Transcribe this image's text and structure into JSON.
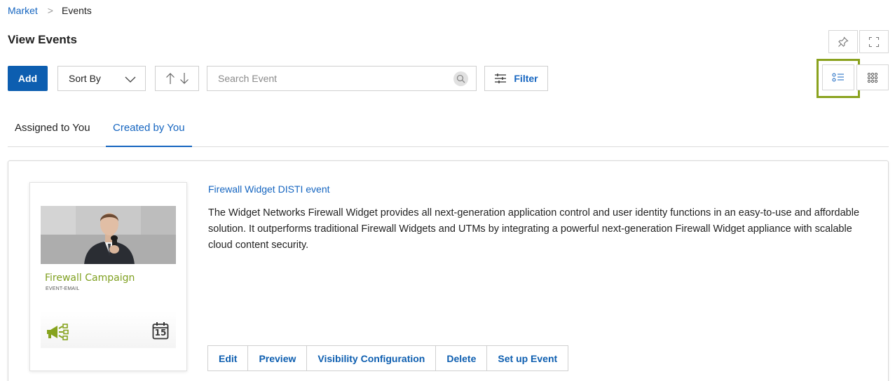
{
  "breadcrumb": {
    "parent": "Market",
    "current": "Events"
  },
  "page": {
    "title": "View Events"
  },
  "toolbar": {
    "add_label": "Add",
    "sort_label": "Sort By",
    "search_placeholder": "Search Event",
    "filter_label": "Filter"
  },
  "tabs": [
    {
      "label": "Assigned to You",
      "active": false
    },
    {
      "label": "Created by You",
      "active": true
    }
  ],
  "event": {
    "title": "Firewall Widget DISTI event",
    "description": "The Widget Networks Firewall Widget provides all next-generation application control and user identity functions in an easy-to-use and affordable solution. It outperforms traditional Firewall Widgets and UTMs by integrating a powerful next-generation Firewall Widget appliance with scalable cloud content security.",
    "thumbnail": {
      "campaign_title": "Firewall Campaign",
      "campaign_type": "EVENT-EMAIL",
      "calendar_day": "15"
    },
    "actions": [
      "Edit",
      "Preview",
      "Visibility Configuration",
      "Delete",
      "Set up Event"
    ]
  },
  "colors": {
    "primary": "#0d5eb0",
    "link": "#1565c0",
    "highlight": "#8aa21e",
    "campaign_green": "#7fa020"
  },
  "icons": [
    "pin-icon",
    "fullscreen-icon",
    "chevron-down-icon",
    "sort-asc-icon",
    "sort-desc-icon",
    "search-icon",
    "filter-icon",
    "list-view-icon",
    "grid-view-icon",
    "megaphone-icon",
    "calendar-icon"
  ]
}
